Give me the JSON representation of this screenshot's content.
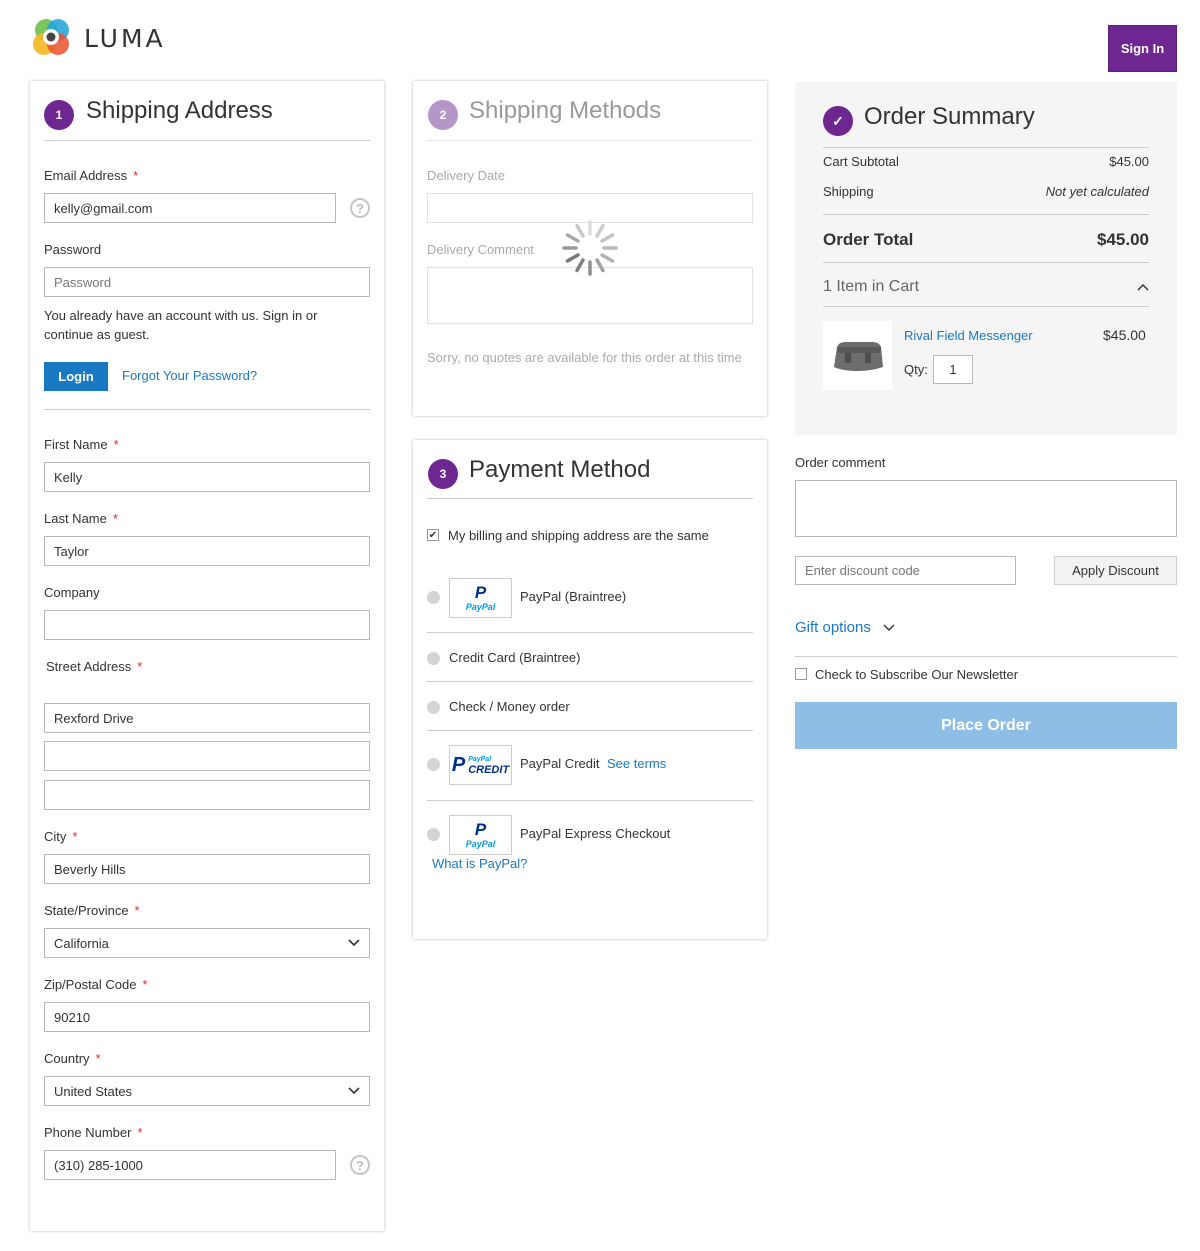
{
  "header": {
    "brand": "LUMA",
    "signin_label": "Sign In"
  },
  "shipping_address": {
    "step": "1",
    "title": "Shipping Address",
    "email_label": "Email Address",
    "email_value": "kelly@gmail.com",
    "password_label": "Password",
    "password_placeholder": "Password",
    "account_note": "You already have an account with us. Sign in or continue as guest.",
    "login_label": "Login",
    "forgot_label": "Forgot Your Password?",
    "first_name_label": "First Name",
    "first_name_value": "Kelly",
    "last_name_label": "Last Name",
    "last_name_value": "Taylor",
    "company_label": "Company",
    "company_value": "",
    "street_label": "Street Address",
    "street_1": "Rexford Drive",
    "street_2": "",
    "street_3": "",
    "city_label": "City",
    "city_value": "Beverly Hills",
    "state_label": "State/Province",
    "state_value": "California",
    "zip_label": "Zip/Postal Code",
    "zip_value": "90210",
    "country_label": "Country",
    "country_value": "United States",
    "phone_label": "Phone Number",
    "phone_value": "(310) 285-1000",
    "required_mark": "*",
    "help_mark": "?"
  },
  "shipping_methods": {
    "step": "2",
    "title": "Shipping Methods",
    "delivery_date_label": "Delivery Date",
    "delivery_comment_label": "Delivery Comment",
    "no_quotes": "Sorry, no quotes are available for this order at this time"
  },
  "payment": {
    "step": "3",
    "title": "Payment Method",
    "same_address": "My billing and shipping address are the same",
    "methods": [
      {
        "label": "PayPal (Braintree)"
      },
      {
        "label": "Credit Card (Braintree)"
      },
      {
        "label": "Check / Money order"
      },
      {
        "label": "PayPal Credit"
      },
      {
        "label": "PayPal Express Checkout"
      }
    ],
    "see_terms": "See terms",
    "what_is_paypal": "What is PayPal?",
    "paypal_logo_text": "PayPal",
    "paypal_credit_small": "PayPal",
    "paypal_credit_big": "CREDIT"
  },
  "summary": {
    "title": "Order Summary",
    "subtotal_label": "Cart Subtotal",
    "subtotal_value": "$45.00",
    "shipping_label": "Shipping",
    "shipping_value": "Not yet calculated",
    "total_label": "Order Total",
    "total_value": "$45.00",
    "items_in_cart": "1 Item in Cart",
    "item_name": "Rival Field Messenger",
    "item_price": "$45.00",
    "qty_label": "Qty:",
    "qty_value": "1"
  },
  "order_comment": {
    "label": "Order comment"
  },
  "discount": {
    "placeholder": "Enter discount code",
    "apply_label": "Apply Discount"
  },
  "gift_options": "Gift options",
  "newsletter": "Check to Subscribe Our Newsletter",
  "place_order": "Place Order",
  "colors": {
    "brand": "#6e2790",
    "link": "#1979c3",
    "place_order": "#8ebde6"
  }
}
